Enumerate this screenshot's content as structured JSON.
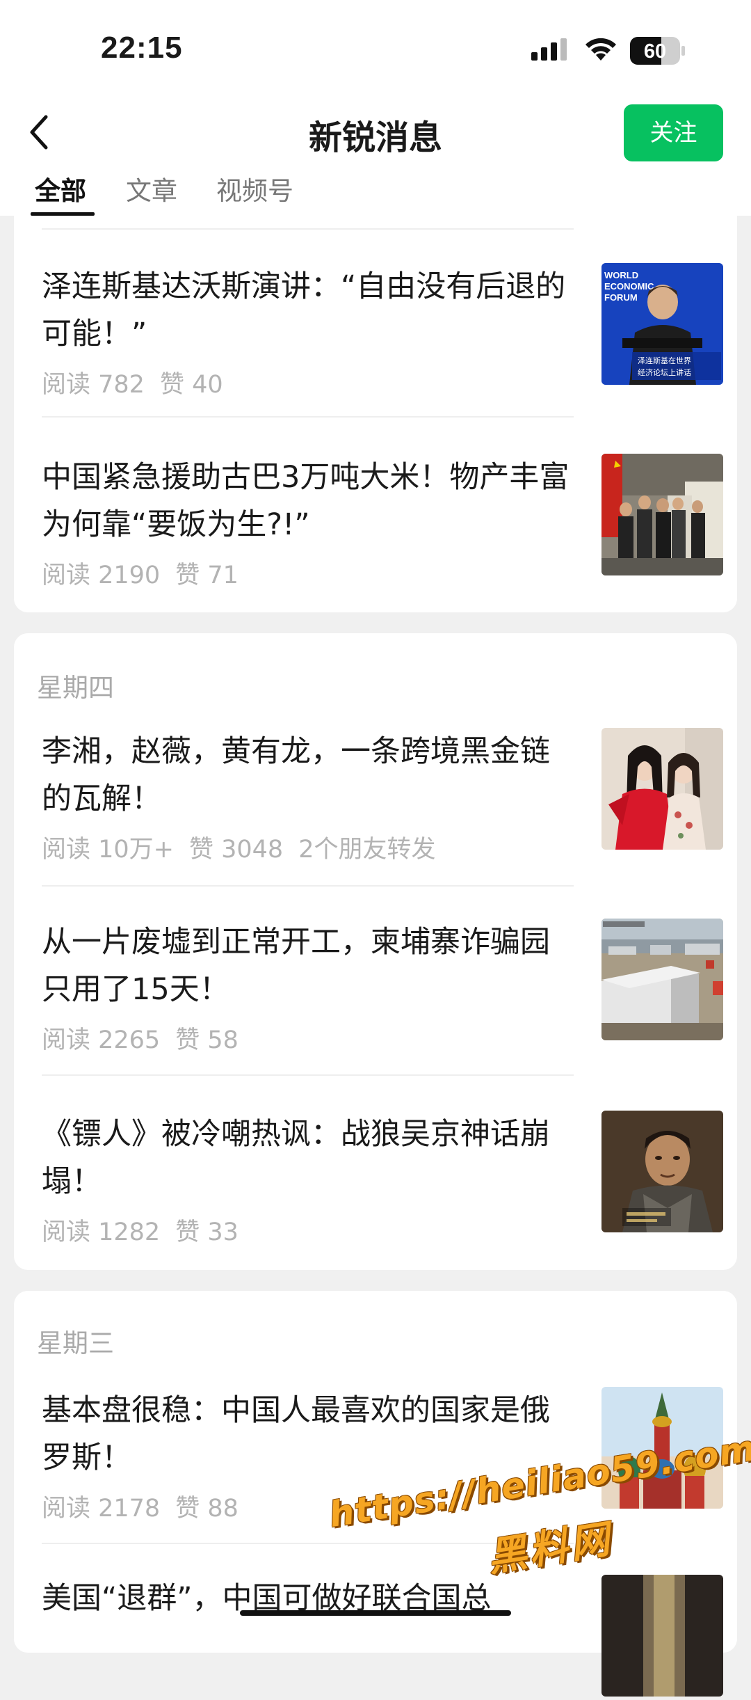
{
  "status_bar": {
    "time": "22:15",
    "battery": "60"
  },
  "header": {
    "title": "新锐消息",
    "follow_label": "关注",
    "tabs": [
      {
        "label": "全部",
        "active": true
      },
      {
        "label": "文章",
        "active": false
      },
      {
        "label": "视频号",
        "active": false
      }
    ]
  },
  "groups": [
    {
      "day": "",
      "articles": [
        {
          "title": "泽连斯基达沃斯演讲：“自由没有后退的可能！”",
          "reads": "阅读 782",
          "likes": "赞 40",
          "shares": "",
          "thumb_text": [
            "WORLD",
            "ECONOMIC",
            "FORUM",
            "泽连斯基在世界",
            "经济论坛上讲话"
          ]
        },
        {
          "title": "中国紧急援助古巴3万吨大米！物产丰富为何靠“要饭为生?!”",
          "reads": "阅读 2190",
          "likes": "赞 71",
          "shares": ""
        }
      ]
    },
    {
      "day": "星期四",
      "articles": [
        {
          "title": "李湘，赵薇，黄有龙，一条跨境黑金链的瓦解！",
          "reads": "阅读 10万+",
          "likes": "赞 3048",
          "shares": "2个朋友转发"
        },
        {
          "title": "从一片废墟到正常开工，柬埔寨诈骗园只用了15天！",
          "reads": "阅读 2265",
          "likes": "赞 58",
          "shares": ""
        },
        {
          "title": "《镖人》被冷嘲热讽：战狼吴京神话崩塌！",
          "reads": "阅读 1282",
          "likes": "赞 33",
          "shares": ""
        }
      ]
    },
    {
      "day": "星期三",
      "articles": [
        {
          "title": "基本盘很稳：中国人最喜欢的国家是俄罗斯！",
          "reads": "阅读 2178",
          "likes": "赞 88",
          "shares": ""
        },
        {
          "title": "美国“退群”，中国可做好联合国总",
          "reads": "",
          "likes": "",
          "shares": ""
        }
      ]
    }
  ],
  "watermark": {
    "url": "https://heiliao59.com",
    "name": "黑料网"
  },
  "colors": {
    "accent": "#07c160",
    "meta": "#b3b3b3",
    "background": "#f0f0f0"
  }
}
